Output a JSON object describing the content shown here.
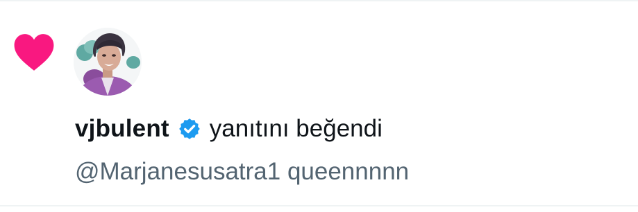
{
  "notification": {
    "type_icon": "heart-icon",
    "heart_color": "#f91880",
    "verified_icon": "verified-badge-icon",
    "verified_color": "#1d9bf0",
    "username": "vjbulent",
    "action_text": "yanıtını beğendi",
    "tweet_text": "@Marjanesusatra1 queennnnn"
  }
}
